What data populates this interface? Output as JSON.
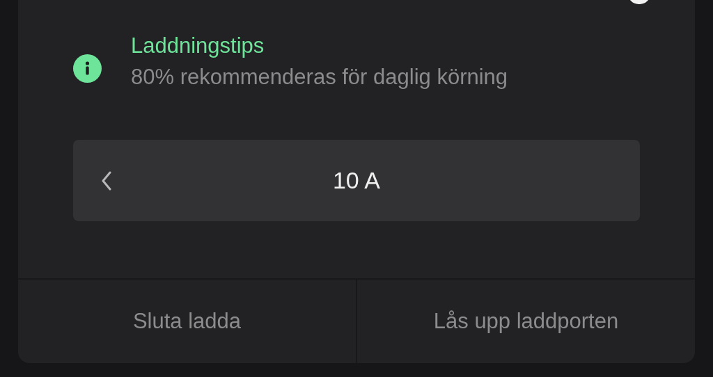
{
  "tip": {
    "title": "Laddningstips",
    "text": "80% rekommenderas för daglig körning"
  },
  "current_selector": {
    "value": "10 A"
  },
  "buttons": [
    {
      "label": "Sluta ladda"
    },
    {
      "label": "Lås upp laddporten"
    }
  ]
}
